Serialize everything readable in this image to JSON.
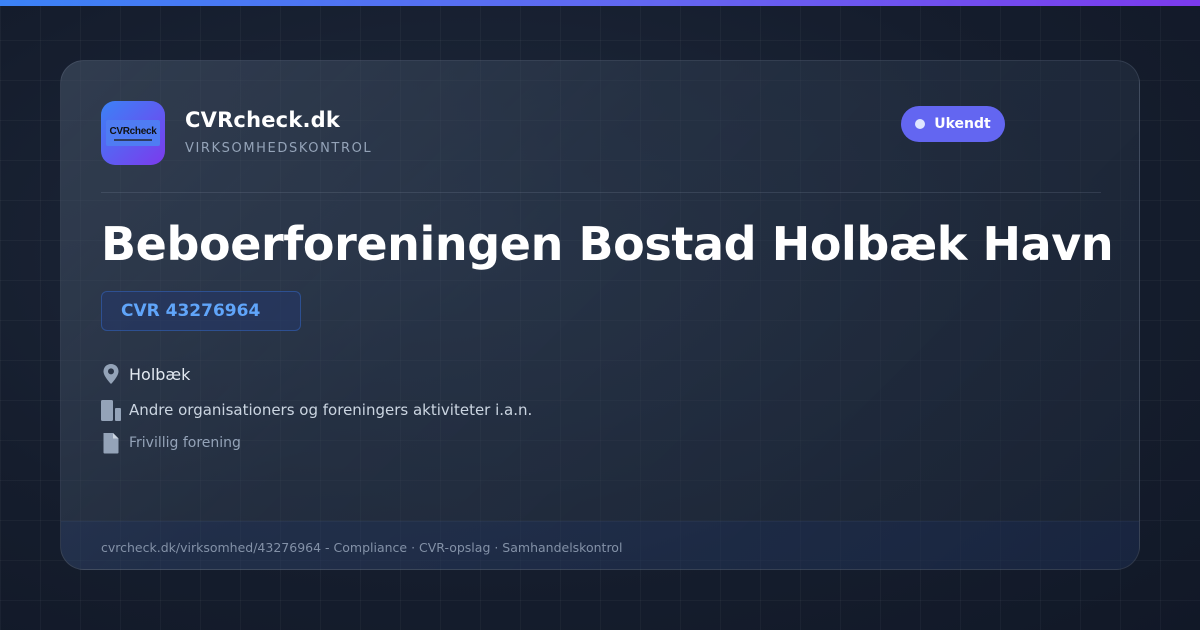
{
  "brand": {
    "logo_text": "CVRcheck",
    "name": "CVRcheck.dk",
    "tagline": "VIRKSOMHEDSKONTROL"
  },
  "status": {
    "label": "Ukendt",
    "color": "#6366f1"
  },
  "company": {
    "name": "Beboerforeningen Bostad Holbæk Havn",
    "cvr": "CVR 43276964"
  },
  "details": [
    {
      "icon": "location-pin-icon",
      "text": "Holbæk"
    },
    {
      "icon": "building-icon",
      "text": "Andre organisationers og foreningers aktiviteter i.a.n."
    },
    {
      "icon": "document-icon",
      "text": "Frivillig forening"
    }
  ],
  "footer": {
    "text": "cvrcheck.dk/virksomhed/43276964 - Compliance · CVR-opslag · Samhandelskontrol"
  },
  "colors": {
    "accent_blue": "#3b82f6",
    "accent_violet": "#7c3aed",
    "cvr_text": "#60a5fa",
    "background": "#141c2c"
  }
}
